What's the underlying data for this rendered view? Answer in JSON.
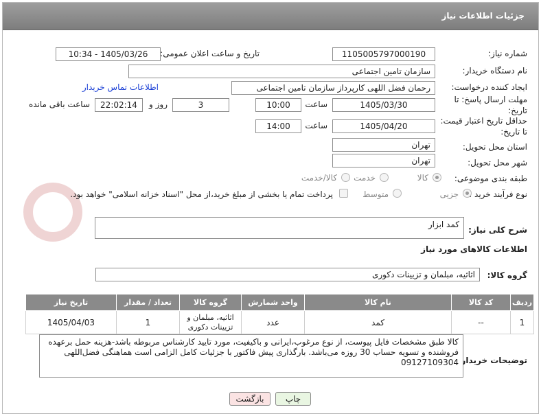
{
  "header": {
    "title": "جزئیات اطلاعات نیاز"
  },
  "fields": {
    "need_number_label": "شماره نیاز:",
    "need_number": "1105005797000190",
    "announce_label": "تاریخ و ساعت اعلان عمومی:",
    "announce_value": "1405/03/26 - 10:34",
    "buyer_org_label": "نام دستگاه خریدار:",
    "buyer_org": "سازمان تامین اجتماعی",
    "creator_label": "ایجاد کننده درخواست:",
    "creator": "رحمان فضل اللهی کارپرداز سازمان تامین اجتماعی",
    "contact_link": "اطلاعات تماس خریدار",
    "deadline_label_1": "مهلت ارسال پاسخ: تا",
    "deadline_label_2": "تاریخ:",
    "deadline_date": "1405/03/30",
    "time_label": "ساعت",
    "deadline_time": "10:00",
    "days_count": "3",
    "days_label": "روز و",
    "remaining_time": "22:02:14",
    "remaining_label": "ساعت باقی مانده",
    "price_label_1": "حداقل تاریخ اعتبار قیمت:",
    "price_label_2": "تا تاریخ:",
    "price_date": "1405/04/20",
    "price_time_label": "ساعت",
    "price_time": "14:00",
    "province_label": "استان محل تحویل:",
    "province": "تهران",
    "city_label": "شهر محل تحویل:",
    "city": "تهران",
    "category_label": "طبقه بندی موضوعی:",
    "category_options": [
      "کالا",
      "خدمت",
      "کالا/خدمت"
    ],
    "process_label": "نوع فرآیند خرید :",
    "process_options": [
      "جزیی",
      "متوسط"
    ],
    "payment_note": "پرداخت تمام یا بخشی از مبلغ خرید،از محل \"اسناد خزانه اسلامی\" خواهد بود."
  },
  "description": {
    "label": "شرح کلی نیاز:",
    "value": "کمد ابزار"
  },
  "goods_section": {
    "title": "اطلاعات کالاهای مورد نیاز"
  },
  "group": {
    "label": "گروه کالا:",
    "value": "اثاثیه، مبلمان و تزیینات دکوری"
  },
  "table": {
    "headers": [
      "ردیف",
      "کد کالا",
      "نام کالا",
      "واحد شمارش",
      "گروه کالا",
      "تعداد / مقدار",
      "تاریخ نیاز"
    ],
    "rows": [
      [
        "1",
        "--",
        "کمد",
        "عدد",
        "اثاثیه، مبلمان و تزیینات دکوری",
        "1",
        "1405/04/03"
      ]
    ]
  },
  "buyer_notes": {
    "label": "توضیحات خریدار:",
    "value": "کالا طبق مشخصات فایل پیوست، از نوع مرغوب،ایرانی و باکیفیت، مورد تایید کارشناس مربوطه باشد-هزینه حمل برعهده فروشنده و تسویه حساب 30 روزه می‌باشد. بارگذاری پیش فاکتور با جزئیات کامل الزامی است هماهنگی فضل‌اللهی 09127109304"
  },
  "buttons": {
    "print": "چاپ",
    "back": "بازگشت"
  },
  "colors": {
    "header_bg": "#8c8c8c",
    "link": "#1a3fd6",
    "back_button_bg": "#fbe3e3",
    "print_button_bg": "#e9f6e2"
  }
}
